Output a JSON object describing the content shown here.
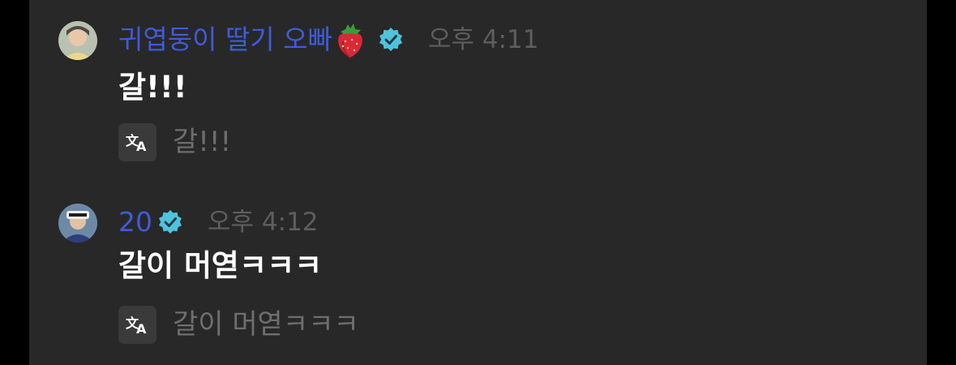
{
  "messages": [
    {
      "author": "귀엽둥이 딸기 오빠",
      "author_emoji": "strawberry-icon",
      "verified": true,
      "time": "오후 4:11",
      "text": "갈!!!",
      "translation": "갈!!!"
    },
    {
      "author": "20",
      "verified": true,
      "time": "오후 4:12",
      "text": "갈이 머엳ㅋㅋㅋ",
      "translation": "갈이 머엳ㅋㅋㅋ"
    }
  ],
  "colors": {
    "background": "#282828",
    "author_name": "#3f5bd8",
    "verified_badge": "#4fc3dc",
    "timestamp": "#5e5e5e",
    "message_text": "#ffffff",
    "translation_text": "#6e6e6e"
  },
  "icons": {
    "verified": "verified-badge-icon",
    "translate": "translate-icon"
  }
}
